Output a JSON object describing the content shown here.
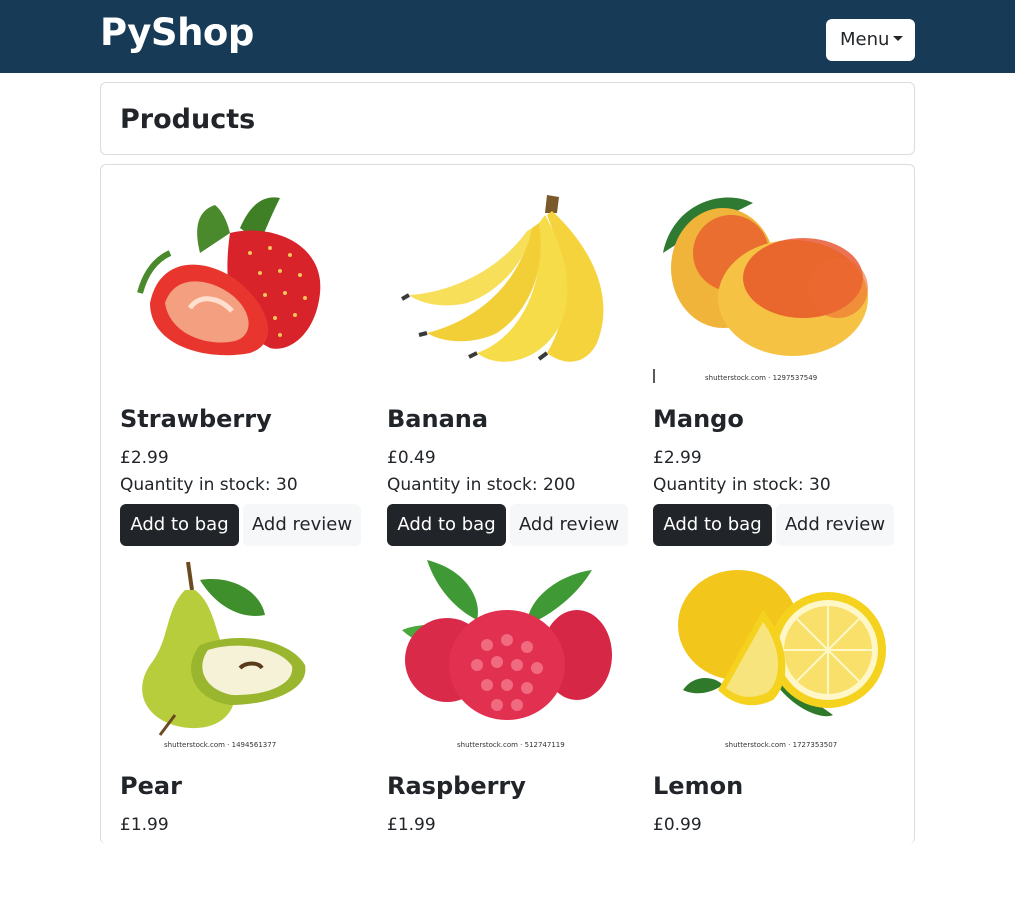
{
  "navbar": {
    "brand": "PyShop",
    "menu_label": "Menu"
  },
  "page": {
    "title": "Products"
  },
  "products": [
    {
      "name": "Strawberry",
      "price": "£2.99",
      "stock": "Quantity in stock: 30",
      "add_label": "Add to bag",
      "review_label": "Add review",
      "watermark": ""
    },
    {
      "name": "Banana",
      "price": "£0.49",
      "stock": "Quantity in stock: 200",
      "add_label": "Add to bag",
      "review_label": "Add review",
      "watermark": ""
    },
    {
      "name": "Mango",
      "price": "£2.99",
      "stock": "Quantity in stock: 30",
      "add_label": "Add to bag",
      "review_label": "Add review",
      "watermark": "shutterstock.com · 1297537549"
    },
    {
      "name": "Pear",
      "price": "£1.99",
      "stock": "",
      "add_label": "",
      "review_label": "",
      "watermark": "shutterstock.com · 1494561377"
    },
    {
      "name": "Raspberry",
      "price": "£1.99",
      "stock": "",
      "add_label": "",
      "review_label": "",
      "watermark": "shutterstock.com · 512747119"
    },
    {
      "name": "Lemon",
      "price": "£0.99",
      "stock": "",
      "add_label": "",
      "review_label": "",
      "watermark": "shutterstock.com · 1727353507"
    }
  ],
  "colors": {
    "navbar_bg": "#173a56",
    "button_dark": "#212529",
    "button_light": "#f6f7f8"
  }
}
